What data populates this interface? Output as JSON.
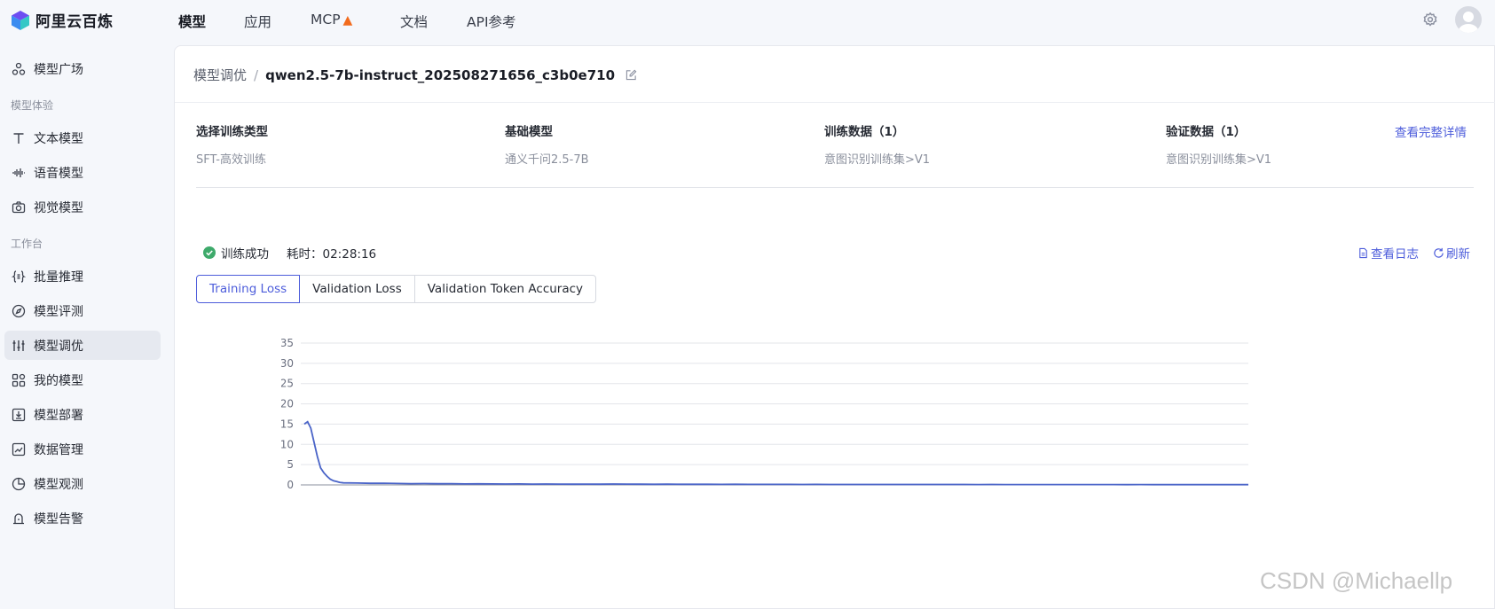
{
  "brand": {
    "name": "阿里云百炼"
  },
  "nav": [
    {
      "label": "模型",
      "active": true
    },
    {
      "label": "应用"
    },
    {
      "label": "MCP",
      "badge_icon": "flame-icon"
    },
    {
      "label": "文档"
    },
    {
      "label": "API参考"
    }
  ],
  "sidebar": {
    "model_plaza": "模型广场",
    "group_experience": "模型体验",
    "text_model": "文本模型",
    "speech_model": "语音模型",
    "vision_model": "视觉模型",
    "group_workbench": "工作台",
    "batch_inference": "批量推理",
    "model_eval": "模型评测",
    "model_tuning": "模型调优",
    "my_models": "我的模型",
    "model_deploy": "模型部署",
    "data_mgmt": "数据管理",
    "model_observe": "模型观测",
    "model_alert": "模型告警"
  },
  "breadcrumb": {
    "root": "模型调优",
    "sep": "/",
    "current": "qwen2.5-7b-instruct_202508271656_c3b0e710"
  },
  "info": {
    "train_type_label": "选择训练类型",
    "train_type_value": "SFT-高效训练",
    "base_model_label": "基础模型",
    "base_model_value": "通义千问2.5-7B",
    "train_data_label": "训练数据（1）",
    "train_data_value": "意图识别训练集>V1",
    "val_data_label": "验证数据（1）",
    "val_data_value": "意图识别训练集>V1",
    "detail_link": "查看完整详情"
  },
  "status": {
    "text": "训练成功",
    "duration": "耗时：02:28:16",
    "color": "#3eaa6b"
  },
  "actions": {
    "view_log": "查看日志",
    "refresh": "刷新"
  },
  "tabs": [
    {
      "label": "Training Loss",
      "active": true
    },
    {
      "label": "Validation Loss"
    },
    {
      "label": "Validation Token Accuracy"
    }
  ],
  "accent_color": "#4d5ddb",
  "chart_data": {
    "type": "line",
    "title": "",
    "xlabel": "",
    "ylabel": "",
    "ylim": [
      0,
      35
    ],
    "yticks": [
      "0",
      "5",
      "10",
      "15",
      "20",
      "25",
      "30",
      "35"
    ],
    "grid": true,
    "series": [
      {
        "color": "#4a64c8",
        "values": [
          15.0,
          15.6,
          14.0,
          10.5,
          7.0,
          4.2,
          3.0,
          2.1,
          1.4,
          1.0,
          0.8,
          0.6,
          0.5,
          0.45,
          0.4,
          0.42,
          0.35,
          0.3,
          0.32,
          0.28,
          0.3,
          0.25,
          0.27,
          0.24,
          0.22,
          0.25,
          0.2,
          0.22,
          0.2,
          0.18,
          0.2,
          0.18,
          0.22,
          0.2,
          0.18,
          0.16,
          0.17,
          0.15,
          0.16,
          0.15,
          0.14,
          0.15,
          0.14,
          0.13,
          0.14,
          0.13,
          0.12,
          0.13,
          0.12,
          0.12,
          0.11,
          0.12,
          0.11,
          0.11,
          0.1,
          0.11,
          0.1,
          0.1,
          0.1,
          0.09,
          0.1,
          0.09,
          0.09,
          0.09,
          0.08,
          0.09,
          0.08,
          0.08,
          0.08,
          0.08,
          0.07,
          0.08,
          0.07,
          0.07,
          0.07,
          0.07,
          0.06,
          0.07,
          0.06,
          0.06
        ]
      }
    ]
  },
  "watermark": "CSDN @Michaellp"
}
